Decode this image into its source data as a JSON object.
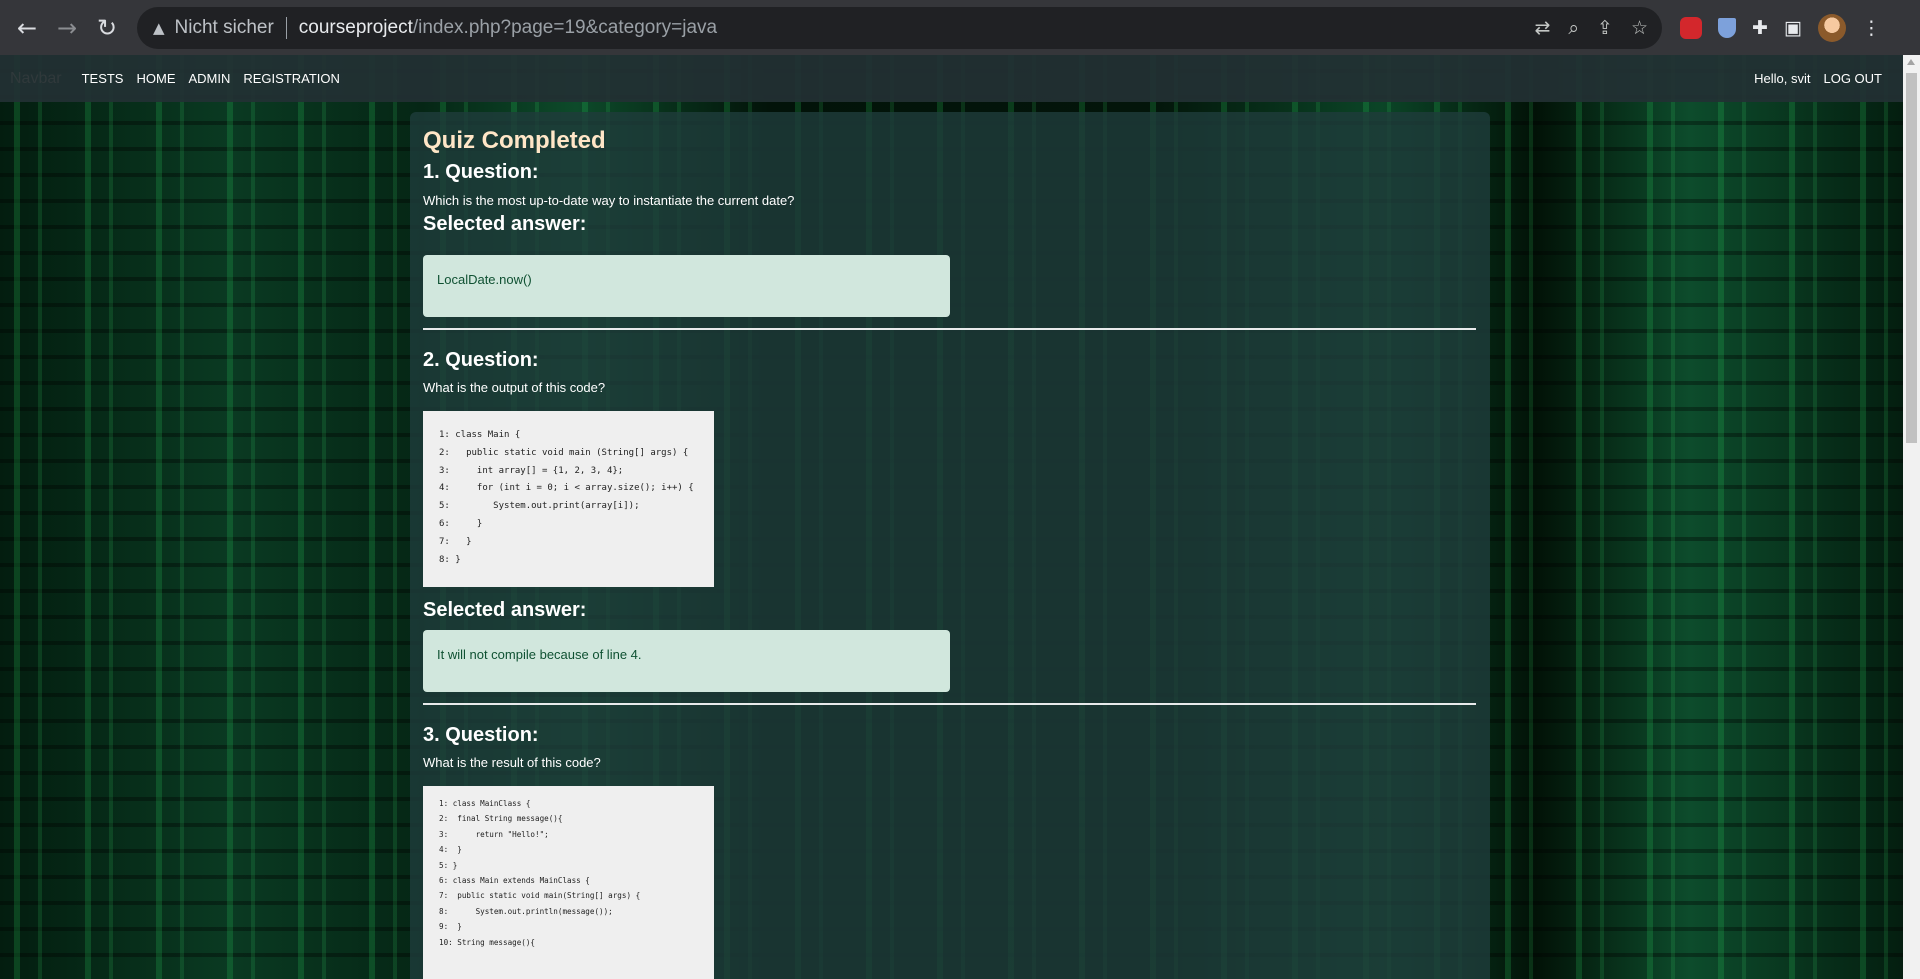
{
  "browser": {
    "insecure_label": "Nicht sicher",
    "url_host": "courseproject",
    "url_path": "/index.php?page=19&category=java"
  },
  "navbar": {
    "brand": "Navbar",
    "links": [
      "TESTS",
      "HOME",
      "ADMIN",
      "REGISTRATION"
    ],
    "greeting": "Hello, svit",
    "logout": "LOG OUT"
  },
  "quiz": {
    "title": "Quiz Completed",
    "selected_answer_label": "Selected answer:",
    "questions": [
      {
        "heading": "1. Question:",
        "text": "Which is the most up-to-date way to instantiate the current date?",
        "answer": "LocalDate.now()"
      },
      {
        "heading": "2. Question:",
        "text": "What is the output of this code?",
        "code": [
          "1: class Main {",
          "2:   public static void main (String[] args) {",
          "3:     int array[] = {1, 2, 3, 4};",
          "4:     for (int i = 0; i < array.size(); i++) {",
          "5:        System.out.print(array[i]);",
          "6:     }",
          "7:   }",
          "8: }"
        ],
        "answer": "It will not compile because of line 4."
      },
      {
        "heading": "3. Question:",
        "text": "What is the result of this code?",
        "code": [
          "1: class MainClass {",
          "2:  final String message(){",
          "3:      return \"Hello!\";",
          "4:  }",
          "5: }",
          "",
          "6: class Main extends MainClass {",
          "7:  public static void main(String[] args) {",
          "8:      System.out.println(message());",
          "9:  }",
          "",
          "10: String message(){"
        ]
      }
    ]
  }
}
